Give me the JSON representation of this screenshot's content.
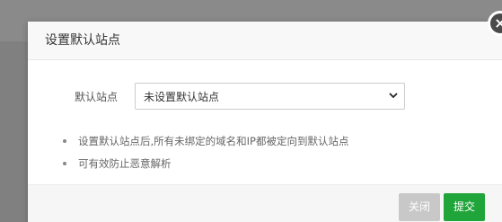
{
  "modal": {
    "title": "设置默认站点",
    "close_symbol": "×"
  },
  "form": {
    "label": "默认站点",
    "select_value": "未设置默认站点"
  },
  "tips": [
    "设置默认站点后,所有未绑定的域名和IP都被定向到默认站点",
    "可有效防止恶意解析"
  ],
  "footer": {
    "close_label": "关闭",
    "submit_label": "提交"
  },
  "colors": {
    "submit": "#20a53a",
    "close": "#c8c8c8"
  }
}
